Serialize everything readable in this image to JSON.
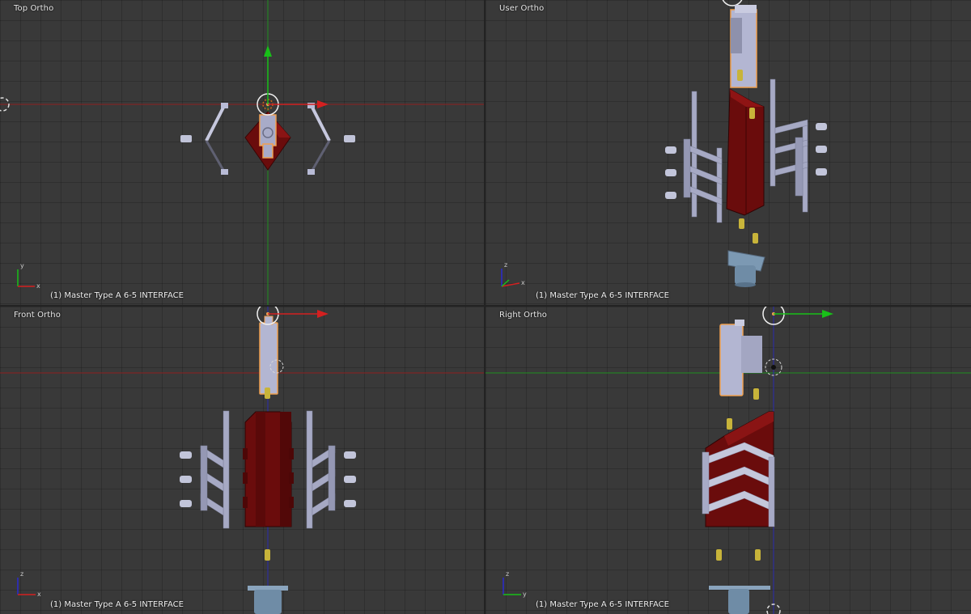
{
  "viewports": {
    "top": {
      "title": "Top Ortho",
      "status": "(1) Master Type A 6-5 INTERFACE"
    },
    "user": {
      "title": "User Ortho",
      "status": "(1) Master Type A 6-5 INTERFACE"
    },
    "front": {
      "title": "Front Ortho",
      "status": "(1) Master Type A 6-5 INTERFACE"
    },
    "right": {
      "title": "Right Ortho",
      "status": "(1) Master Type A 6-5 INTERFACE"
    }
  },
  "colors": {
    "viewport_bg": "#393939",
    "x_axis": "#d42020",
    "y_axis": "#18c018",
    "z_axis": "#2a2ad0",
    "body_red": "#6a0c0c",
    "part_lavender": "#a8abc8",
    "selection_outline": "#f0a050",
    "pin_yellow": "#c8b43a",
    "base_blue": "#6f8ca6"
  }
}
